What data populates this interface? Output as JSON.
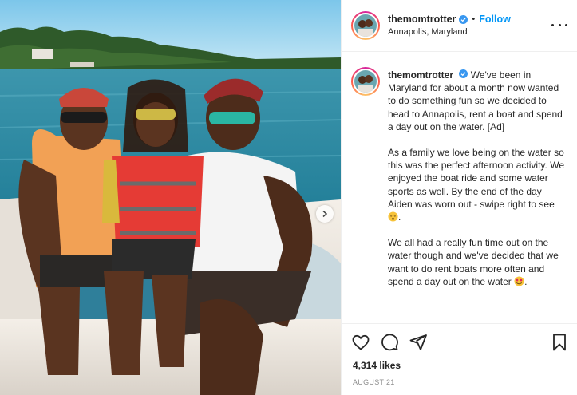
{
  "header": {
    "username": "themomtrotter",
    "separator": "•",
    "follow_label": "Follow",
    "location": "Annapolis, Maryland"
  },
  "caption": {
    "username": "themomtrotter",
    "paragraphs": [
      "We've been in Maryland for about a month now wanted to do something fun so we decided to head to Annapolis, rent a boat and spend a day out on the water. [Ad]",
      "As a family we love being on the water so this was the perfect afternoon activity. We enjoyed the boat ride and some water sports as well. By the end of the day Aiden was worn out - swipe right to see",
      "We all had a really fun time out on the water though and we've decided that we want to do rent boats more often and spend a day out on the water"
    ],
    "end_mark": "."
  },
  "stats": {
    "likes": "4,314 likes",
    "date": "AUGUST 21"
  },
  "icons": {
    "verified": "verified-badge-icon",
    "more": "more-options-icon",
    "like": "heart-icon",
    "comment": "comment-icon",
    "share": "paper-plane-icon",
    "save": "bookmark-icon",
    "next": "chevron-right-icon",
    "emoji_sleep": "sleeping-face-emoji",
    "emoji_love": "smiling-face-with-hearts-emoji"
  },
  "colors": {
    "accent_blue": "#0095f6",
    "text": "#262626",
    "muted": "#8e8e8e",
    "divider": "#efefef"
  }
}
